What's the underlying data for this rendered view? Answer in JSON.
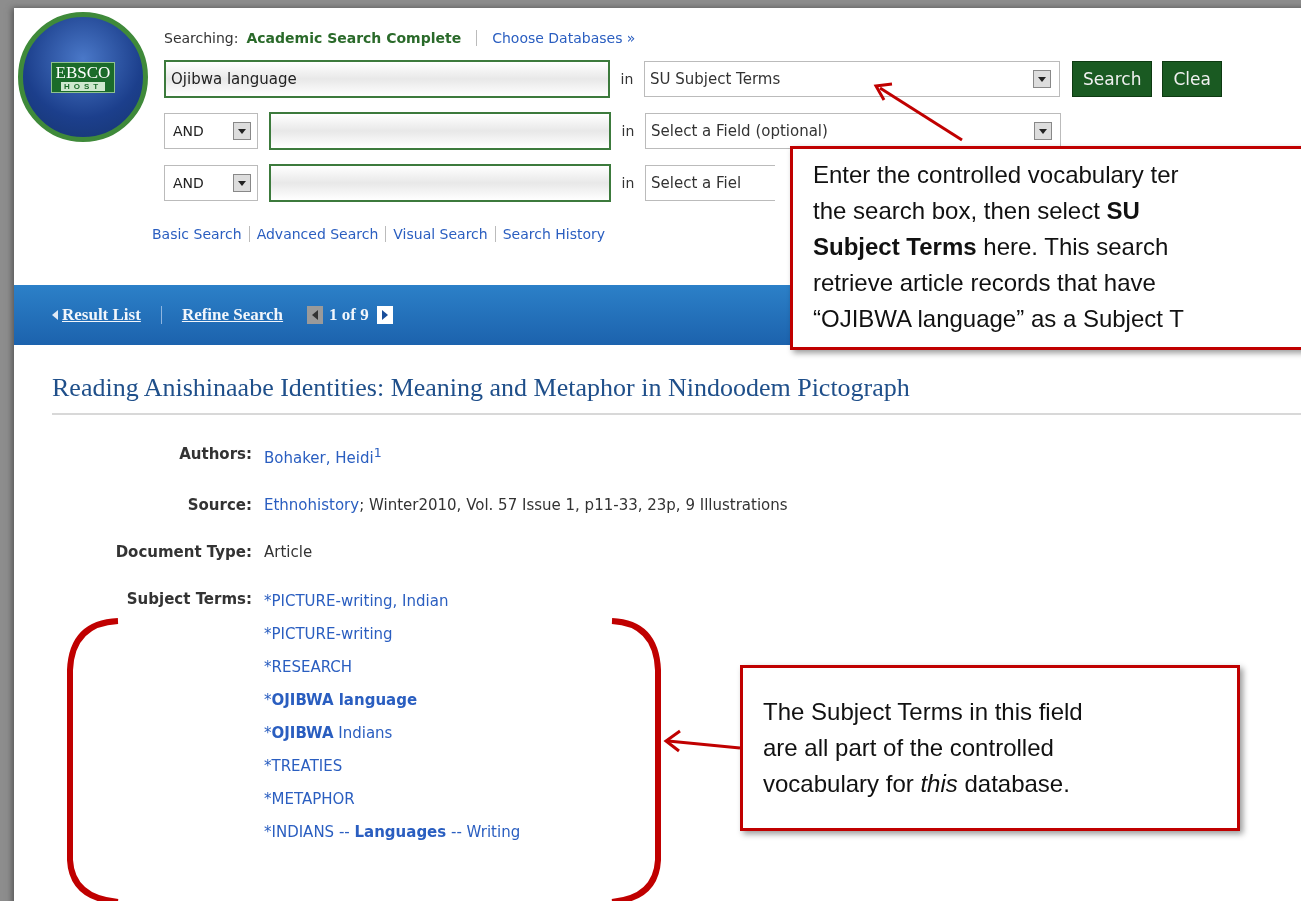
{
  "logo": {
    "line_1": "EBSCO",
    "line_2": "HOST"
  },
  "searching": {
    "label": "Searching:",
    "database": "Academic Search Complete",
    "choose_link": "Choose Databases »"
  },
  "search_rows": [
    {
      "value": "Ojibwa language",
      "in_label": "in",
      "field": "SU Subject Terms"
    },
    {
      "operator": "AND",
      "in_label": "in",
      "field": "Select a Field (optional)"
    },
    {
      "operator": "AND",
      "in_label": "in",
      "field": "Select a Fiel"
    }
  ],
  "buttons": [
    "Search",
    "Clea"
  ],
  "nav_links": [
    "Basic Search",
    "Advanced Search",
    "Visual Search",
    "Search History"
  ],
  "result_nav": {
    "result_list": "Result List",
    "refine_search": "Refine Search",
    "position": "1 of 9"
  },
  "title": "Reading Anishinaabe Identities: Meaning and Metaphor in Nindoodem Pictograph",
  "fields": [
    {
      "kind": "link",
      "label": "Authors:",
      "value": "Bohaker, Heidi$^{1}$"
    },
    {
      "kind": "source",
      "label": "Source:",
      "link": "Ethnohistory",
      "value": "; Winter2010, Vol. 57 Issue 1, p11-33, 23p, 9 Illustrations"
    },
    {
      "kind": "text",
      "label": "Document Type:",
      "value": "Article"
    },
    {
      "kind": "terms",
      "label": "Subject Terms:",
      "terms": [
        {
          "mark": "*",
          "text": "PICTURE-writing, Indian"
        },
        {
          "mark": "*",
          "text": "PICTURE-writing"
        },
        {
          "mark": "*",
          "text": "RESEARCH"
        },
        {
          "mark": "*",
          "text": "**OJIBWA language**"
        },
        {
          "mark": "*",
          "text": "**OJIBWA** Indians"
        },
        {
          "mark": "*",
          "text": "TREATIES"
        },
        {
          "mark": "*",
          "text": "METAPHOR"
        },
        {
          "mark": "*",
          "text": "INDIANS -- **Languages** -- Writing"
        }
      ]
    }
  ],
  "callouts": [
    {
      "lines": [
        "Enter the controlled vocabulary ter",
        "the search box, then select  **SU**",
        "**Subject Terms**  here. This search",
        "retrieve article records  that have",
        "“OJIBWA language” as a Subject T"
      ]
    },
    {
      "lines": [
        "The Subject Terms in this field",
        "are all part of the controlled",
        "vocabulary for *this* database."
      ]
    }
  ]
}
